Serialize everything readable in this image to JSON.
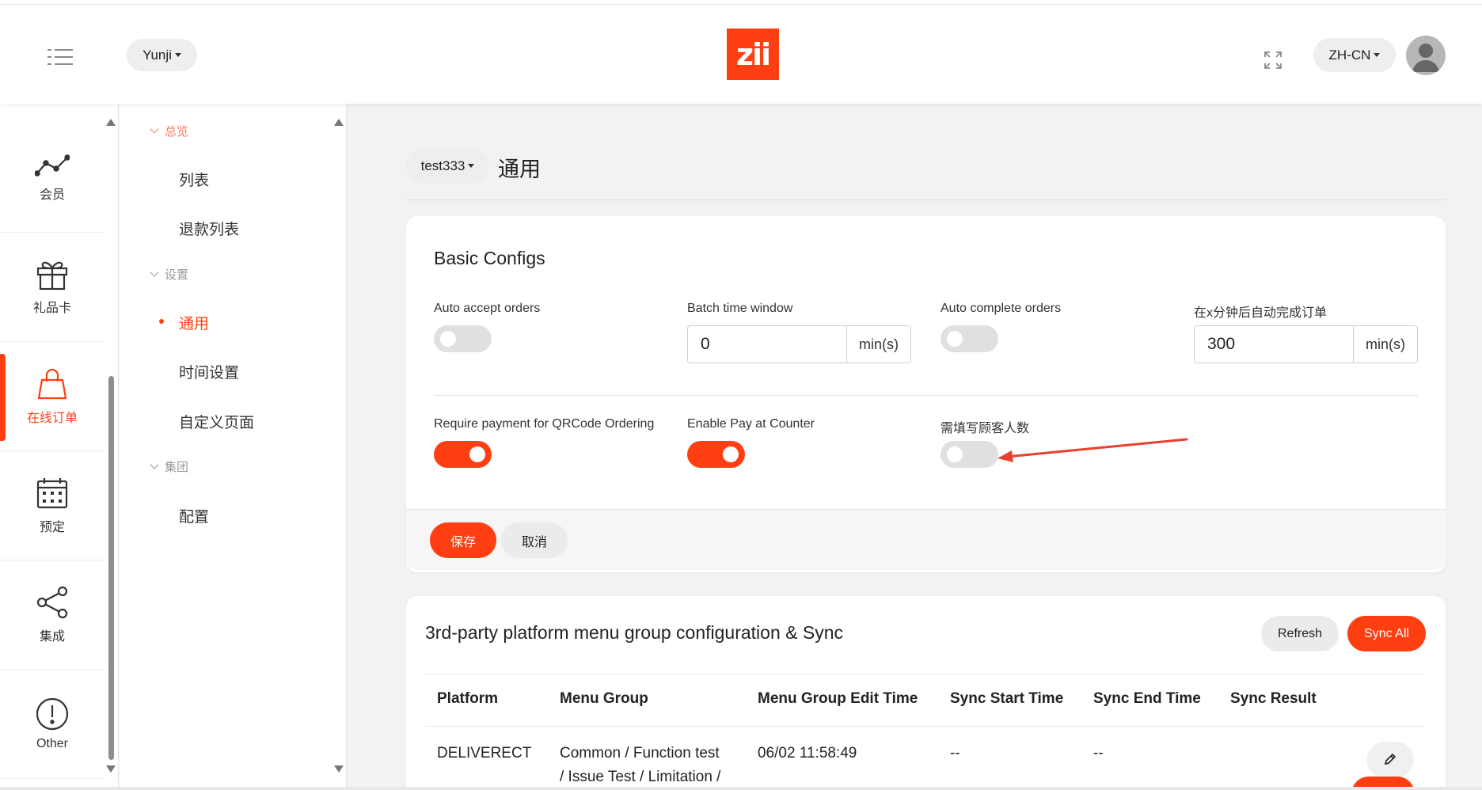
{
  "header": {
    "org_selector": "Yunji",
    "logo_text": "zii",
    "language": "ZH-CN"
  },
  "rail": {
    "items": [
      {
        "label": "会员",
        "icon": "trend-line-icon"
      },
      {
        "label": "礼品卡",
        "icon": "gift-icon"
      },
      {
        "label": "在线订单",
        "icon": "shopping-bag-icon",
        "active": true
      },
      {
        "label": "预定",
        "icon": "calendar-icon"
      },
      {
        "label": "集成",
        "icon": "share-icon"
      },
      {
        "label": "Other",
        "icon": "alert-circle-icon"
      }
    ]
  },
  "submenu": {
    "group_overview": "总览",
    "item_list": "列表",
    "item_refund_list": "退款列表",
    "group_settings": "设置",
    "item_general": "通用",
    "item_time_settings": "时间设置",
    "item_custom_page": "自定义页面",
    "group_group": "集团",
    "item_config": "配置"
  },
  "page": {
    "store_selector": "test333",
    "title": "通用"
  },
  "basic_configs": {
    "title": "Basic Configs",
    "auto_accept_label": "Auto accept orders",
    "auto_accept_on": false,
    "batch_window_label": "Batch time window",
    "batch_window_value": "0",
    "batch_window_unit": "min(s)",
    "auto_complete_label": "Auto complete orders",
    "auto_complete_on": false,
    "auto_complete_after_label": "在x分钟后自动完成订单",
    "auto_complete_after_value": "300",
    "auto_complete_after_unit": "min(s)",
    "require_payment_label": "Require payment for QRCode Ordering",
    "require_payment_on": true,
    "pay_at_counter_label": "Enable Pay at Counter",
    "pay_at_counter_on": true,
    "guest_count_label": "需填写顾客人数",
    "guest_count_on": false,
    "save_label": "保存",
    "cancel_label": "取消"
  },
  "sync_section": {
    "title": "3rd-party platform menu group configuration & Sync",
    "refresh_label": "Refresh",
    "sync_all_label": "Sync All",
    "columns": [
      "Platform",
      "Menu Group",
      "Menu Group Edit Time",
      "Sync Start Time",
      "Sync End Time",
      "Sync Result"
    ],
    "rows": [
      {
        "platform": "DELIVERECT",
        "menu_group_line1": "Common / Function test",
        "menu_group_line2": "/ Issue Test / Limitation /",
        "edit_time": "06/02 11:58:49",
        "sync_start": "--",
        "sync_end": "--",
        "sync_result": ""
      }
    ]
  },
  "colors": {
    "accent": "#ff3f12",
    "annotation_arrow": "#e8402e"
  }
}
